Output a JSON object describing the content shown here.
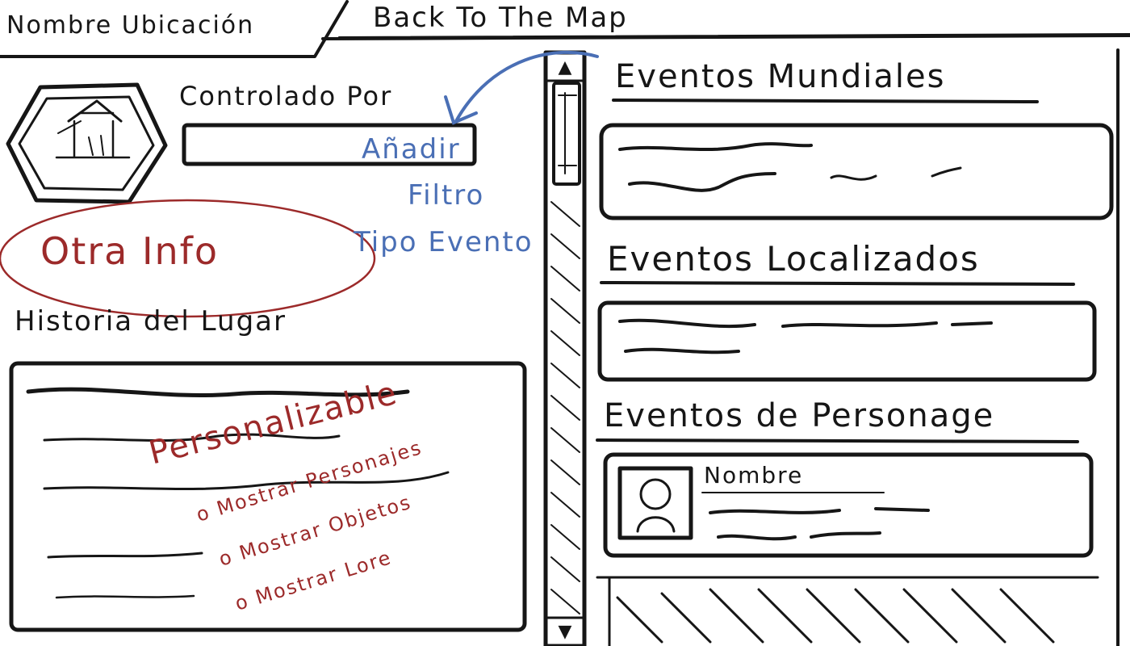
{
  "header": {
    "location_name_tab": "Nombre Ubicación",
    "back_to_map": "Back To The Map"
  },
  "location": {
    "icon": "house-hexagon-icon",
    "controlled_by_label": "Controlado Por",
    "controlled_by_value": "",
    "other_info_note": "Otra Info",
    "history_label": "Historia del Lugar"
  },
  "annotations": {
    "filter_note_lines": [
      "Añadir",
      "Filtro",
      "Tipo Evento"
    ],
    "customizable_title": "Personalizable",
    "customizable_options": [
      "o Mostrar Personajes",
      "o Mostrar Objetos",
      "o Mostrar Lore"
    ]
  },
  "events": {
    "world_title": "Eventos Mundiales",
    "localized_title": "Eventos Localizados",
    "character_title": "Eventos de Personage",
    "character_card": {
      "name_label": "Nombre",
      "avatar_icon": "person-avatar-icon"
    }
  },
  "scrollbar": {
    "up_icon": "chevron-up-icon",
    "down_icon": "chevron-down-icon"
  }
}
